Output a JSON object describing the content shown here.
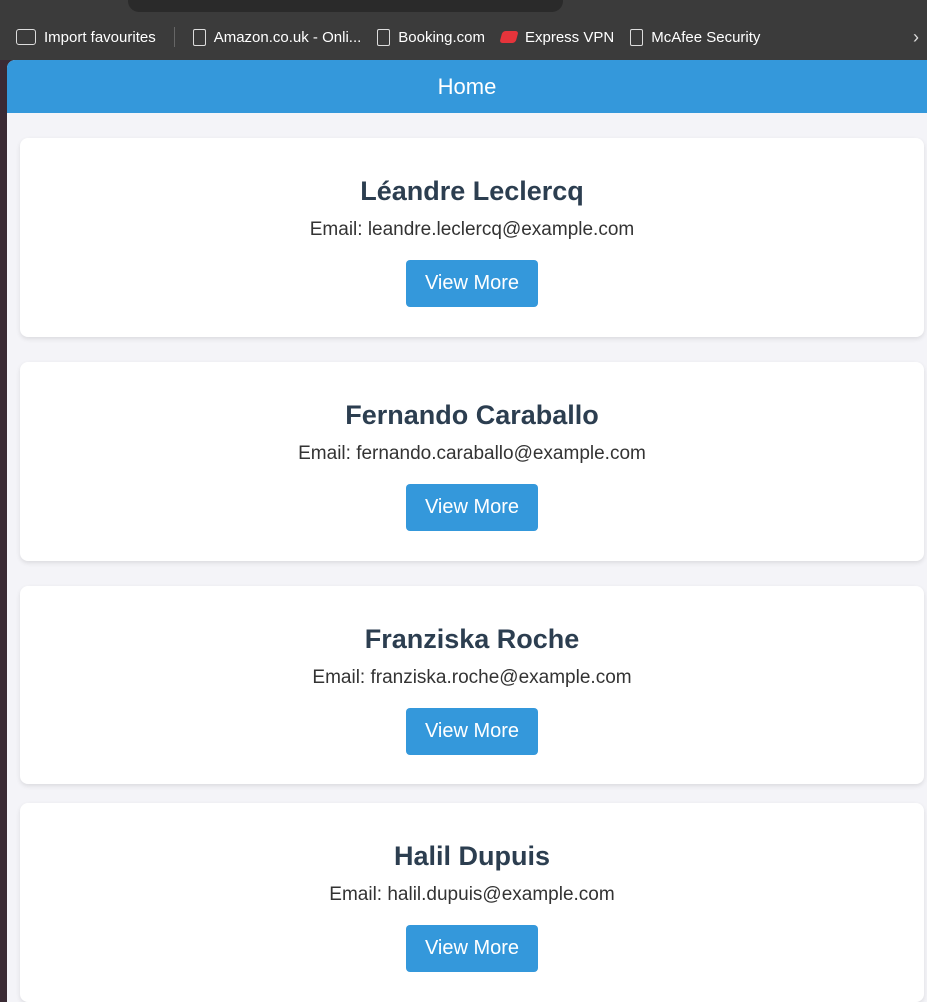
{
  "bookmarks": [
    {
      "label": "Import favourites",
      "icon": "folder-import-icon"
    },
    {
      "label": "Amazon.co.uk - Onli...",
      "icon": "page-icon"
    },
    {
      "label": "Booking.com",
      "icon": "page-icon"
    },
    {
      "label": "Express VPN",
      "icon": "expressvpn-icon"
    },
    {
      "label": "McAfee Security",
      "icon": "page-icon"
    }
  ],
  "more": "›",
  "header": {
    "title": "Home"
  },
  "users": [
    {
      "name": "Léandre Leclercq",
      "email": "Email: leandre.leclercq@example.com",
      "button": "View More"
    },
    {
      "name": "Fernando Caraballo",
      "email": "Email: fernando.caraballo@example.com",
      "button": "View More"
    },
    {
      "name": "Franziska Roche",
      "email": "Email: franziska.roche@example.com",
      "button": "View More"
    },
    {
      "name": "Halil Dupuis",
      "email": "Email: halil.dupuis@example.com",
      "button": "View More"
    }
  ],
  "colors": {
    "accent": "#3498db",
    "text": "#2c3e50"
  }
}
